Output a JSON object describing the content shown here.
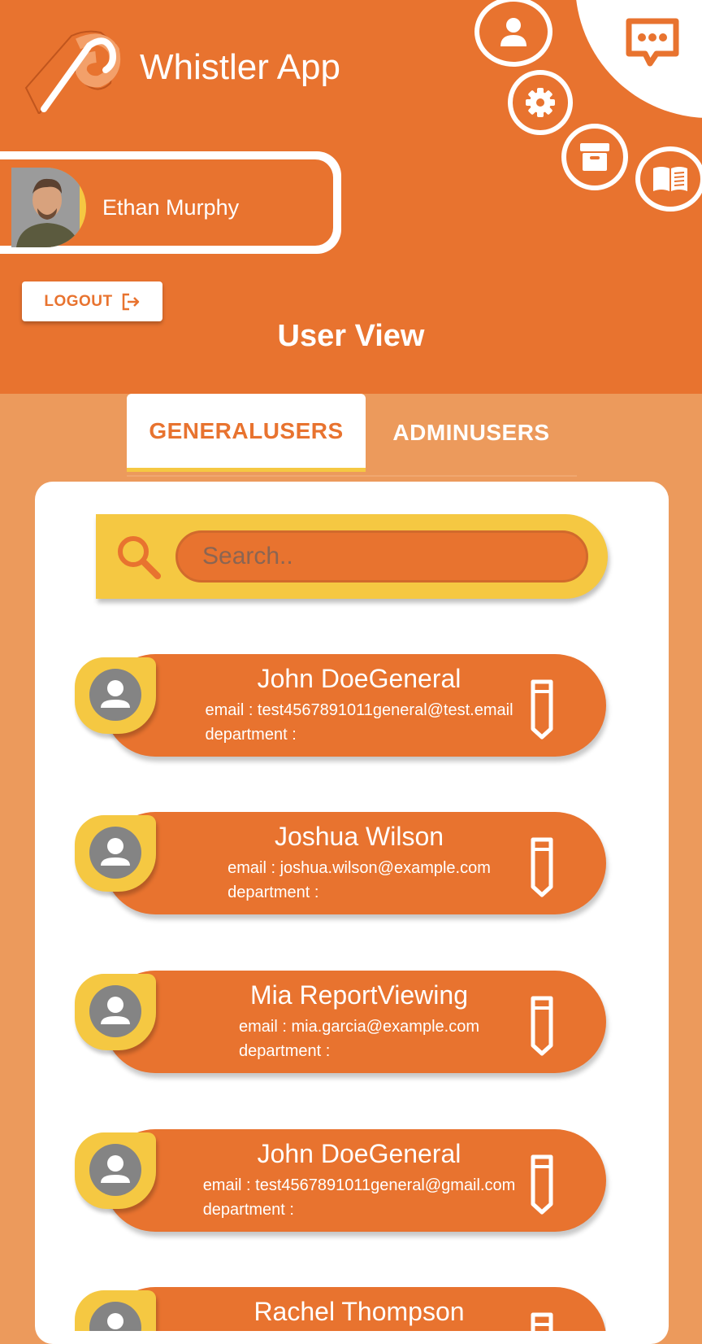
{
  "app": {
    "title": "Whistler App"
  },
  "profile": {
    "name": "Ethan Murphy"
  },
  "logout": {
    "label": "LOGOUT"
  },
  "page": {
    "title": "User View"
  },
  "tabs": [
    {
      "label": "GENERALUSERS",
      "active": true
    },
    {
      "label": "ADMINUSERS",
      "active": false
    }
  ],
  "search": {
    "placeholder": "Search..",
    "value": ""
  },
  "users": [
    {
      "name": "John DoeGeneral",
      "email": "email : test4567891011general@test.email",
      "department": "department :"
    },
    {
      "name": "Joshua Wilson",
      "email": "email : joshua.wilson@example.com",
      "department": "department :"
    },
    {
      "name": "Mia ReportViewing",
      "email": "email : mia.garcia@example.com",
      "department": "department :"
    },
    {
      "name": "John DoeGeneral",
      "email": "email : test4567891011general@gmail.com",
      "department": "department :"
    },
    {
      "name": "Rachel Thompson",
      "email": "",
      "department": ""
    }
  ],
  "colors": {
    "primary": "#e8732f",
    "accent": "#f5c842",
    "background": "#ec9a5c"
  },
  "icons": [
    "whistle-logo-icon",
    "user-icon",
    "gear-icon",
    "archive-icon",
    "book-icon",
    "chat-icon",
    "logout-icon",
    "search-icon",
    "person-icon",
    "pencil-icon"
  ]
}
